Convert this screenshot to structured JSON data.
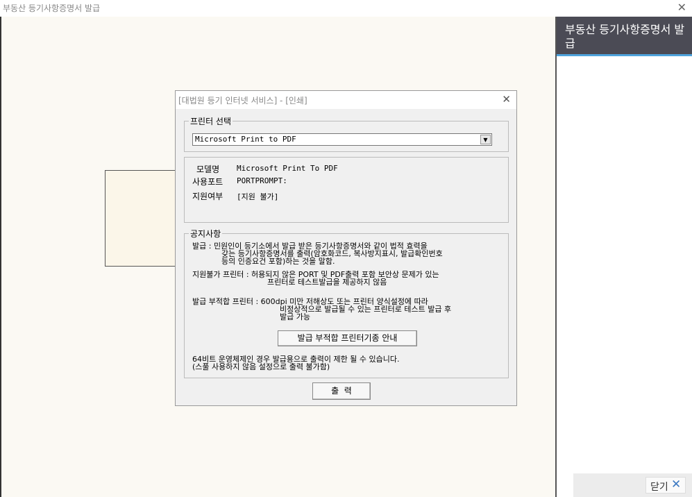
{
  "window": {
    "title": "부동산 등기사항증명서 발급",
    "close_glyph": "✕"
  },
  "side_panel": {
    "title": "부동산 등기사항증명서 발급",
    "close_label": "닫기",
    "close_glyph": "✕"
  },
  "dialog": {
    "title": "[대법원 등기 인터넷 서비스] - [인쇄]",
    "close_glyph": "✕",
    "printer_section": {
      "legend": "프린터 선택",
      "selected": "Microsoft Print to PDF",
      "arrow": "▼"
    },
    "info": {
      "model_label": "모델명",
      "model_value": "Microsoft Print To PDF",
      "port_label": "사용포트",
      "port_value": "PORTPROMPT:",
      "support_label": "지원여부",
      "support_value": "[지원 불가]"
    },
    "notice": {
      "legend": "공지사항",
      "issue_line1": "발급 : 민원인이 등기소에서 발급 받은 등기사항증명서와 같이 법적 효력을",
      "issue_line2": "갖는 등기사항증명서를 출력(암호화코드, 복사방지표시, 발급확인번호",
      "issue_line3": "등의 인증요건 포함)하는 것을 말함.",
      "unsupported_line1": "지원불가 프린터 : 허용되지 않은 PORT 및 PDF출력 포함 보안상 문제가 있는",
      "unsupported_line2": "프린터로 테스트발급을 제공하지 않음",
      "unsuitable_line1": "발급 부적합 프린터 : 600dpi 미만 저해상도 또는 프린터 양식설정에 따라",
      "unsuitable_line2": "비정상적으로 발급될 수 있는 프린터로 테스트 발급 후",
      "unsuitable_line3": "발급 가능",
      "guide_button": "발급 부적합 프린터기종 안내",
      "os_line1": "64비트 운영체제인 경우 발급용으로 출력이 제한 될 수 있습니다.",
      "os_line2": "(스풀 사용하지 않음 설정으로 출력 불가함)"
    },
    "print_button": "출  력"
  }
}
